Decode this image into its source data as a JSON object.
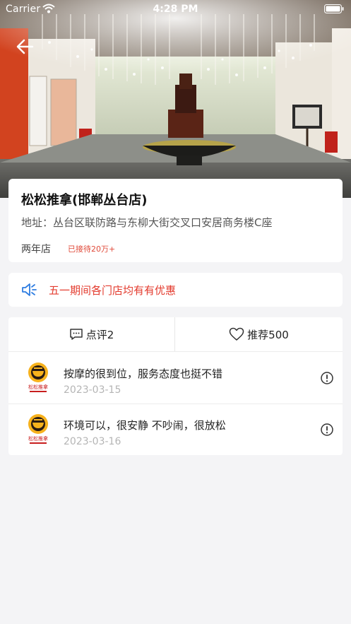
{
  "status_bar": {
    "carrier": "Carrier",
    "time": "4:28 PM"
  },
  "store": {
    "name": "松松推拿(邯郸丛台店)",
    "address": "地址：丛台区联防路与东柳大街交叉口安居商务楼C座",
    "tag": "两年店",
    "served": "已接待20万+"
  },
  "promo": {
    "icon": "speaker-icon",
    "text": "五一期间各门店均有有优惠"
  },
  "tabs": {
    "reviews_label": "点评2",
    "recommend_label": "推荐500"
  },
  "reviews": [
    {
      "text": "按摩的很到位，服务态度也挺不错",
      "date": "2023-03-15",
      "avatar_text": "松松推拿"
    },
    {
      "text": "环境可以，很安静 不吵闹，很放松",
      "date": "2023-03-16",
      "avatar_text": "松松推拿"
    }
  ],
  "colors": {
    "accent_red": "#e33b2e",
    "served_red": "#e04a3a",
    "speaker_blue": "#2f7de1",
    "background": "#f4f4f6"
  }
}
